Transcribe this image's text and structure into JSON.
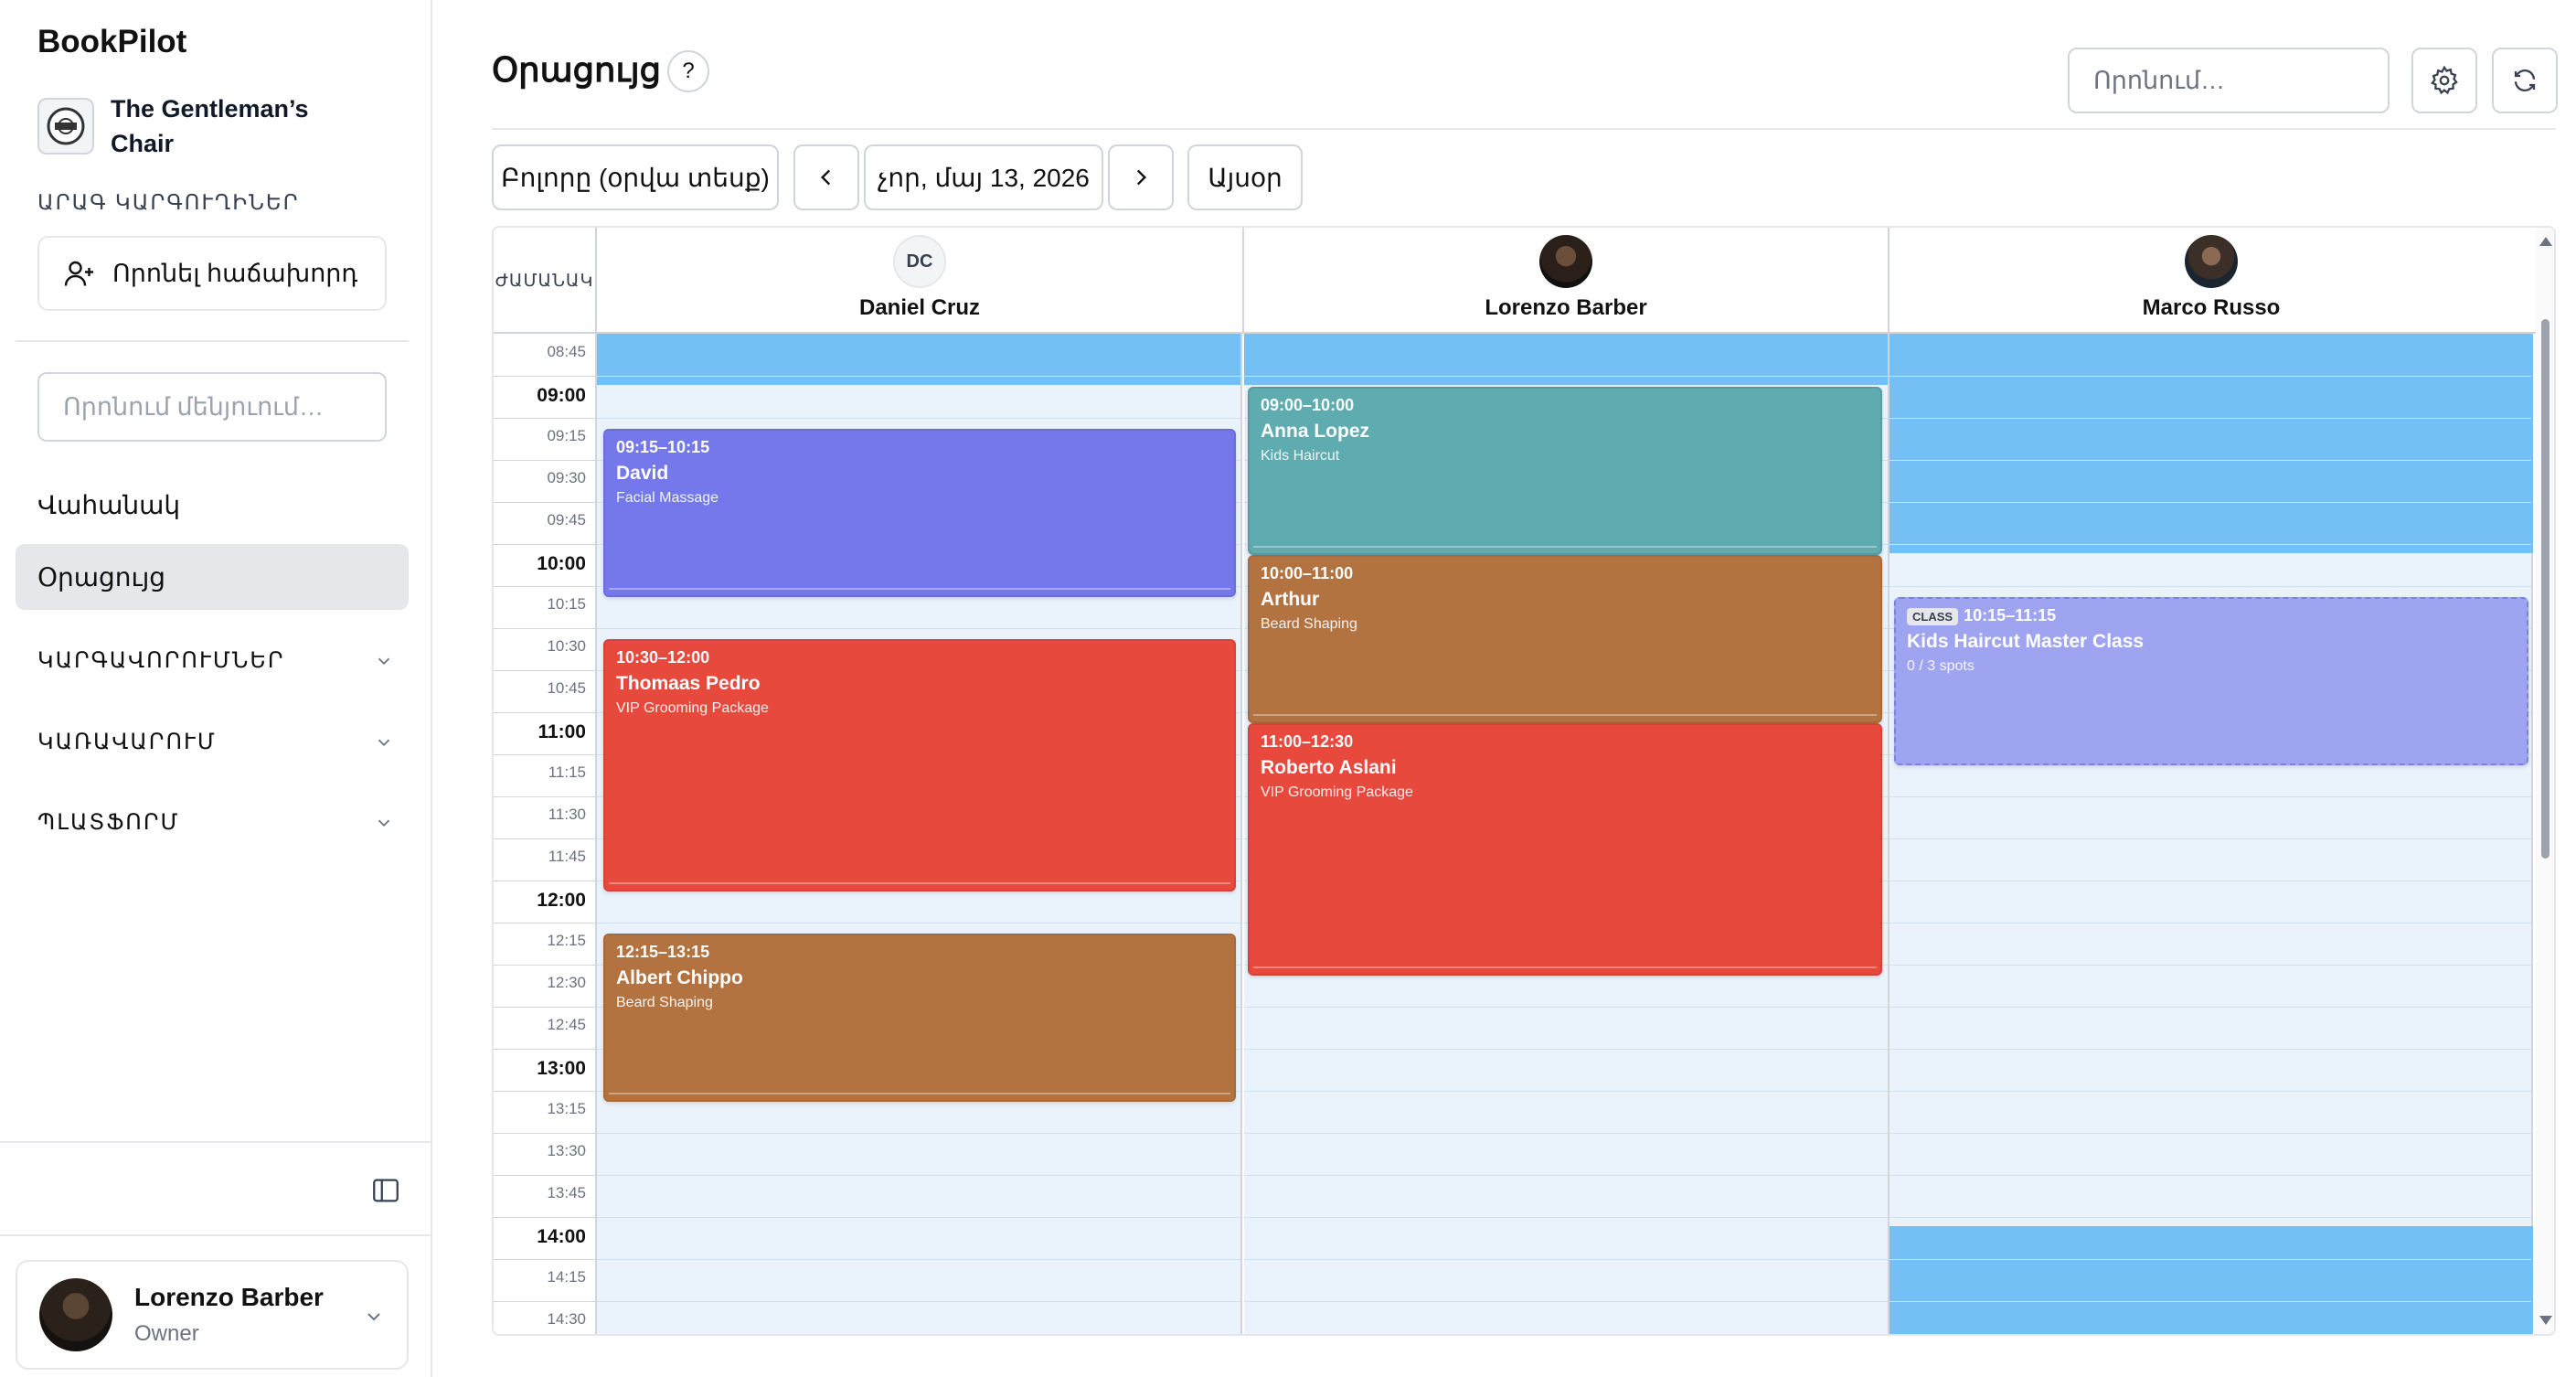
{
  "sidebar": {
    "brand": "BookPilot",
    "business_name": "The Gentleman’s Chair",
    "quick_actions_label": "ԱՐԱԳ ԿԱՐԳՈՒՂԻՆԵՐ",
    "find_client_label": "Որոնել հաճախորդ",
    "menu_search_placeholder": "Որոնում մենյուում…",
    "nav": {
      "dashboard": "Վահանակ",
      "calendar": "Օրացույց"
    },
    "groups": {
      "settings": "ԿԱՐԳԱՎՈՐՈՒՄՆԵՐ",
      "management": "ԿԱՌԱՎԱՐՈՒՄ",
      "platform": "ՊԼԱՏՖՈՐՄ"
    },
    "user": {
      "name": "Lorenzo Barber",
      "role": "Owner"
    }
  },
  "header": {
    "title": "Օրացույց",
    "help": "?",
    "search_placeholder": "Որոնում…"
  },
  "toolbar": {
    "view": "Բոլորը (օրվա տեսք)",
    "date": "չոր, մայ 13, 2026",
    "today": "Այսօր"
  },
  "calendar": {
    "time_header": "ԺԱՄԱՆԱԿ",
    "resources": [
      {
        "name": "Daniel Cruz",
        "initials": "DC"
      },
      {
        "name": "Lorenzo Barber",
        "initials": ""
      },
      {
        "name": "Marco Russo",
        "initials": ""
      }
    ],
    "times": [
      "08:45",
      "09:00",
      "09:15",
      "09:30",
      "09:45",
      "10:00",
      "10:15",
      "10:30",
      "10:45",
      "11:00",
      "11:15",
      "11:30",
      "11:45",
      "12:00",
      "12:15",
      "12:30",
      "12:45",
      "13:00",
      "13:15",
      "13:30",
      "13:45",
      "14:00",
      "14:15",
      "14:30"
    ],
    "appointments": [
      {
        "col": 0,
        "time": "09:15–10:15",
        "name": "David",
        "service": "Facial Massage",
        "color": "#7478ea"
      },
      {
        "col": 0,
        "time": "10:30–12:00",
        "name": "Thomaas Pedro",
        "service": "VIP Grooming Package",
        "color": "#e8493d"
      },
      {
        "col": 0,
        "time": "12:15–13:15",
        "name": "Albert Chippo",
        "service": "Beard Shaping",
        "color": "#b37341"
      },
      {
        "col": 1,
        "time": "09:00–10:00",
        "name": "Anna Lopez",
        "service": "Kids Haircut",
        "color": "#5eabb0"
      },
      {
        "col": 1,
        "time": "10:00–11:00",
        "name": "Arthur",
        "service": "Beard Shaping",
        "color": "#b37341"
      },
      {
        "col": 1,
        "time": "11:00–12:30",
        "name": "Roberto Aslani",
        "service": "VIP Grooming Package",
        "color": "#e8493d"
      },
      {
        "col": 2,
        "badge": "CLASS",
        "time": "10:15–11:15",
        "name": "Kids Haircut Master Class",
        "service": "0 / 3 spots",
        "color": "#9fa4f0"
      }
    ]
  },
  "colors": {
    "unavailable": "#74c0f4",
    "available": "#eaf3fb"
  }
}
